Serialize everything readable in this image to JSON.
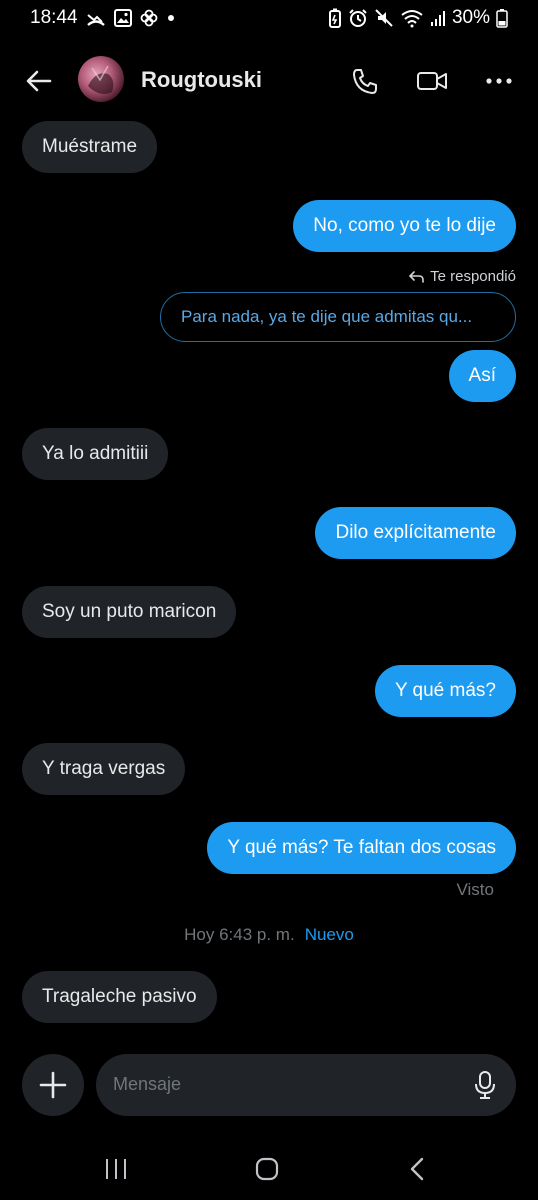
{
  "status_bar": {
    "time": "18:44",
    "battery_percent": "30%",
    "left_icons": [
      "missed-call-icon",
      "gallery-icon",
      "pinwheel-icon",
      "dot-icon"
    ],
    "right_icons": [
      "battery-saver-icon",
      "alarm-icon",
      "mute-icon",
      "wifi-icon",
      "signal-icon",
      "battery-icon"
    ]
  },
  "header": {
    "contact_name": "Rougtouski",
    "back_icon": "arrow-left-icon",
    "call_icon": "phone-icon",
    "video_icon": "video-camera-icon",
    "more_icon": "more-horizontal-icon"
  },
  "messages": [
    {
      "direction": "in",
      "text": "Muéstrame"
    },
    {
      "direction": "out",
      "text": "No, como yo te lo dije"
    },
    {
      "direction": "out",
      "text": "Así",
      "reply": {
        "label": "Te respondió",
        "quoted": "Para nada, ya te dije que admitas qu..."
      }
    },
    {
      "direction": "in",
      "text": "Ya lo admitiii"
    },
    {
      "direction": "out",
      "text": "Dilo explícitamente"
    },
    {
      "direction": "in",
      "text": "Soy un puto maricon"
    },
    {
      "direction": "out",
      "text": "Y qué más?"
    },
    {
      "direction": "in",
      "text": "Y traga vergas"
    },
    {
      "direction": "out",
      "text": "Y qué más? Te faltan dos cosas"
    },
    {
      "direction": "in",
      "text": "Tragaleche pasivo"
    }
  ],
  "seen_label": "Visto",
  "date_divider": {
    "time": "Hoy 6:43 p. m.",
    "new_label": "Nuevo"
  },
  "composer": {
    "placeholder": "Mensaje",
    "add_icon": "plus-icon",
    "mic_icon": "microphone-icon"
  },
  "nav_bar": {
    "recents_icon": "recents-icon",
    "home_icon": "home-icon",
    "back_icon": "nav-back-icon"
  },
  "colors": {
    "accent": "#1d9bf0",
    "incoming_bubble": "#202327",
    "background": "#000000"
  }
}
